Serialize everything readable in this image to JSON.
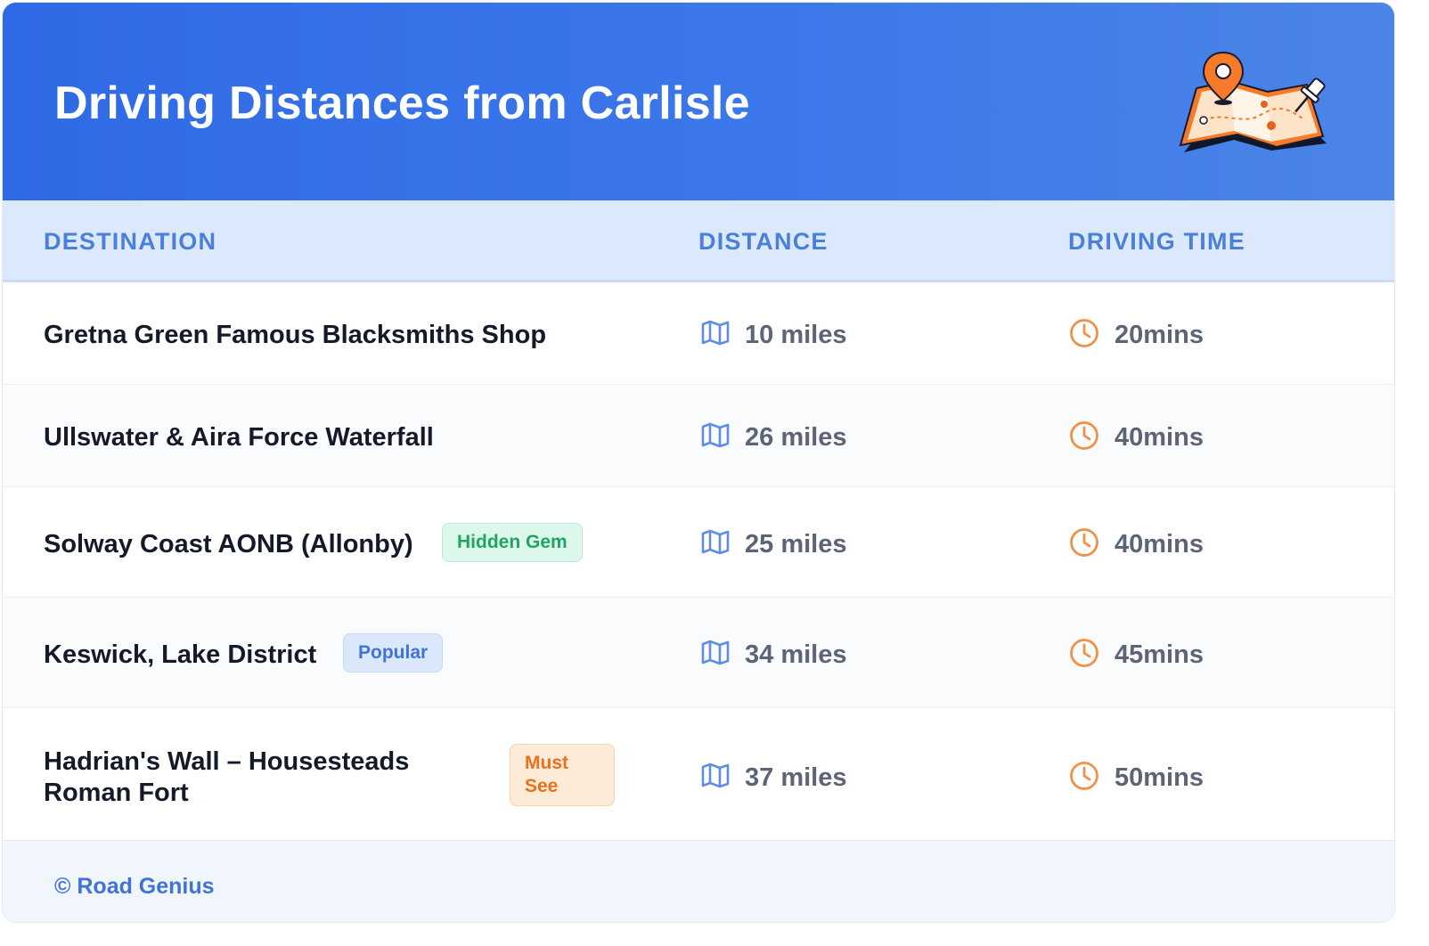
{
  "header": {
    "title": "Driving Distances from Carlisle",
    "illustration": "map-with-pins-illustration",
    "color_start": "#2f6ae6",
    "color_end": "#4b85e6"
  },
  "table": {
    "columns": [
      "DESTINATION",
      "DISTANCE",
      "DRIVING TIME"
    ],
    "rows": [
      {
        "destination": "Gretna Green Famous Blacksmiths Shop",
        "badge": null,
        "distance": "10 miles",
        "time": "20mins"
      },
      {
        "destination": "Ullswater & Aira Force Waterfall",
        "badge": null,
        "distance": "26 miles",
        "time": "40mins"
      },
      {
        "destination": "Solway Coast AONB (Allonby)",
        "badge": "Hidden Gem",
        "distance": "25 miles",
        "time": "40mins"
      },
      {
        "destination": "Keswick, Lake District",
        "badge": "Popular",
        "distance": "34 miles",
        "time": "45mins"
      },
      {
        "destination_lines": [
          "Hadrian's Wall – Housesteads",
          "Roman Fort"
        ],
        "badge_lines": [
          "Must",
          "See"
        ],
        "distance": "37 miles",
        "time": "50mins"
      }
    ],
    "icons": {
      "distance": "map-icon",
      "time": "clock-icon"
    }
  },
  "colors": {
    "accent": "#3f73d8",
    "header_text": "#4a80da",
    "badge_green": "#1fa463",
    "badge_blue": "#3f73d8",
    "badge_orange": "#e8711c",
    "clock": "#f0914a"
  },
  "footer": {
    "text": "© Road Genius"
  }
}
